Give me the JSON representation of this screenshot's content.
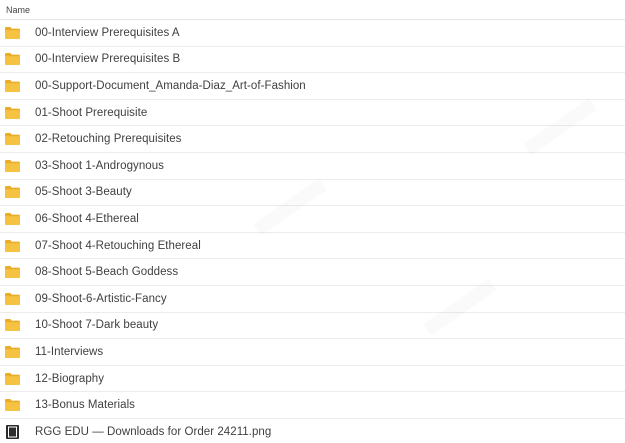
{
  "header": {
    "name_label": "Name"
  },
  "items": [
    {
      "type": "folder",
      "name": "00-Interview Prerequisites A"
    },
    {
      "type": "folder",
      "name": "00-Interview Prerequisites B"
    },
    {
      "type": "folder",
      "name": "00-Support-Document_Amanda-Diaz_Art-of-Fashion"
    },
    {
      "type": "folder",
      "name": "01-Shoot Prerequisite"
    },
    {
      "type": "folder",
      "name": "02-Retouching Prerequisites"
    },
    {
      "type": "folder",
      "name": "03-Shoot 1-Androgynous"
    },
    {
      "type": "folder",
      "name": "05-Shoot 3-Beauty"
    },
    {
      "type": "folder",
      "name": "06-Shoot 4-Ethereal"
    },
    {
      "type": "folder",
      "name": "07-Shoot 4-Retouching Ethereal"
    },
    {
      "type": "folder",
      "name": "08-Shoot 5-Beach Goddess"
    },
    {
      "type": "folder",
      "name": "09-Shoot-6-Artistic-Fancy"
    },
    {
      "type": "folder",
      "name": "10-Shoot 7-Dark beauty"
    },
    {
      "type": "folder",
      "name": "11-Interviews"
    },
    {
      "type": "folder",
      "name": "12-Biography"
    },
    {
      "type": "folder",
      "name": "13-Bonus Materials"
    },
    {
      "type": "file",
      "name": "RGG EDU — Downloads for Order 24211.png"
    }
  ],
  "colors": {
    "folder": "#f5c242",
    "folder_dark": "#e9ad2a",
    "file_icon": "#2b2b2b"
  }
}
